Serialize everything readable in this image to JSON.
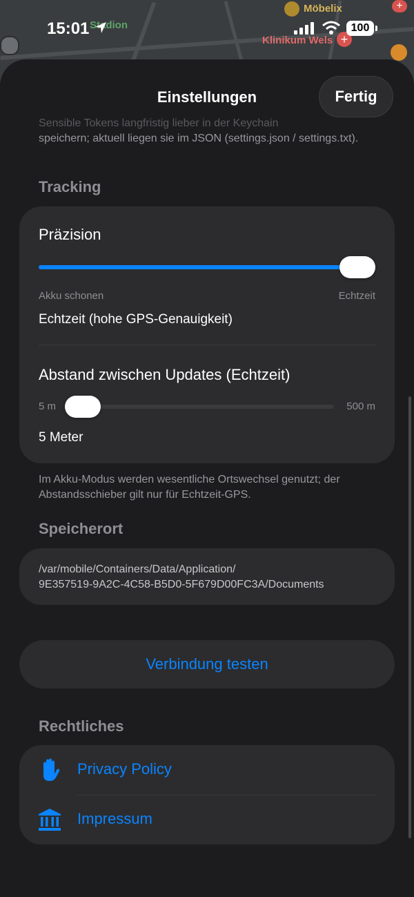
{
  "status_bar": {
    "time": "15:01",
    "battery": "100"
  },
  "map": {
    "label_stadion": "Stadion",
    "label_moebelix": "Möbelix",
    "label_klinikum": "Klinikum Wels"
  },
  "nav": {
    "title": "Einstellungen",
    "done_label": "Fertig"
  },
  "token_note": {
    "faded_line": "Sensible Tokens langfristig lieber in der Keychain",
    "text": "speichern; aktuell liegen sie im JSON (settings.json / settings.txt)."
  },
  "tracking": {
    "section_title": "Tracking",
    "precision": {
      "label": "Präzision",
      "min_label": "Akku schonen",
      "max_label": "Echtzeit",
      "value": 1.0,
      "value_text": "Echtzeit (hohe GPS-Genauigkeit)"
    },
    "distance": {
      "label": "Abstand zwischen Updates (Echtzeit)",
      "min_label": "5 m",
      "max_label": "500 m",
      "value": 5,
      "value_text": "5 Meter"
    },
    "footnote": "Im Akku-Modus werden wesentliche Ortswechsel genutzt; der Abstandsschieber gilt nur für Echtzeit-GPS."
  },
  "storage": {
    "section_title": "Speicherort",
    "path_line1": "/var/mobile/Containers/Data/Application/",
    "path_line2": "9E357519-9A2C-4C58-B5D0-5F679D00FC3A/Documents"
  },
  "test_button": {
    "label": "Verbindung testen"
  },
  "legal": {
    "section_title": "Rechtliches",
    "items": [
      {
        "label": "Privacy Policy",
        "icon": "hand-raised-icon"
      },
      {
        "label": "Impressum",
        "icon": "building-columns-icon"
      }
    ]
  },
  "colors": {
    "accent": "#0a84ff",
    "sheet_background": "#1c1c1e",
    "card_background": "#2c2c2e"
  }
}
